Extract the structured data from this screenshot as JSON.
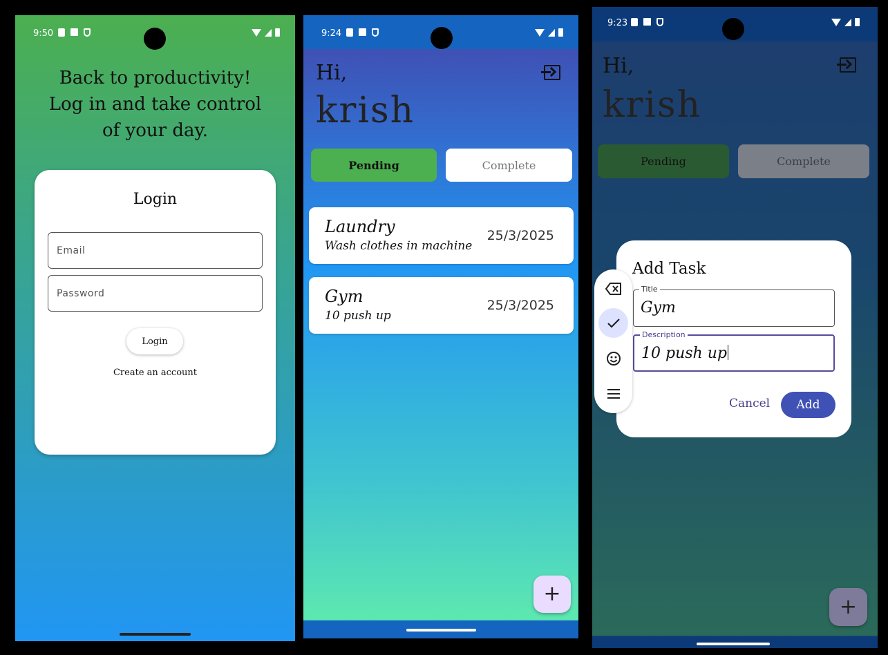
{
  "phones": [
    {
      "status": {
        "time": "9:50"
      },
      "login": {
        "headline": "Back to productivity! Log in and take control of your day.",
        "card_title": "Login",
        "email_placeholder": "Email",
        "password_placeholder": "Password",
        "login_button": "Login",
        "create_account": "Create an account"
      }
    },
    {
      "status": {
        "time": "9:24"
      },
      "greeting": "Hi,",
      "user": "krish",
      "tabs": [
        {
          "label": "Pending"
        },
        {
          "label": "Complete"
        }
      ],
      "tasks": [
        {
          "title": "Laundry",
          "description": "Wash clothes in machine",
          "date": "25/3/2025"
        },
        {
          "title": "Gym",
          "description": "10 push up",
          "date": "25/3/2025"
        }
      ],
      "fab": "+"
    },
    {
      "status": {
        "time": "9:23"
      },
      "greeting": "Hi,",
      "user": "krish",
      "tabs": [
        {
          "label": "Pending"
        },
        {
          "label": "Complete"
        }
      ],
      "dialog": {
        "title": "Add Task",
        "title_label": "Title",
        "title_value": "Gym",
        "description_label": "Description",
        "description_value": "10 push up",
        "cancel": "Cancel",
        "add": "Add"
      },
      "keyboard_toolbar": [
        "backspace-icon",
        "check-icon",
        "emoji-icon",
        "menu-icon"
      ],
      "fab": "+"
    }
  ],
  "colors": {
    "pending_green": "#4caf50",
    "accent_indigo": "#3f51b5",
    "fab_lavender": "#eadcff"
  }
}
